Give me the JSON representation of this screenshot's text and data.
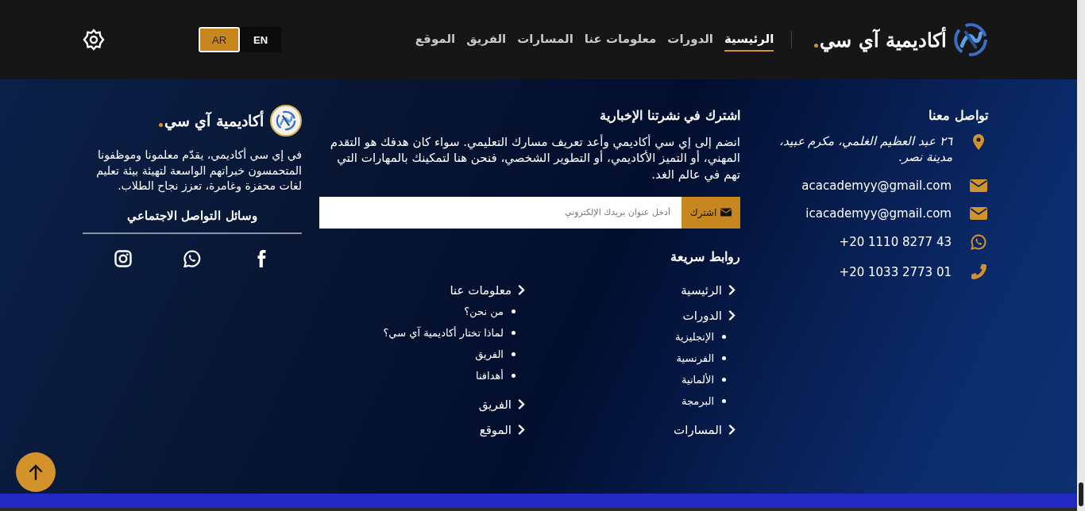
{
  "header": {
    "brand": "أكاديمية آي سي",
    "nav": [
      {
        "label": "الرئيسية",
        "selected": true
      },
      {
        "label": "الدورات",
        "selected": false
      },
      {
        "label": "معلومات عنا",
        "selected": false
      },
      {
        "label": "المسارات",
        "selected": false
      },
      {
        "label": "الفريق",
        "selected": false
      },
      {
        "label": "الموقع",
        "selected": false
      }
    ],
    "languages": [
      {
        "label": "EN",
        "selected": false
      },
      {
        "label": "AR",
        "selected": true
      }
    ]
  },
  "contact": {
    "title": "تواصل معنا",
    "items": [
      {
        "kind": "location",
        "text": "٢٦ عبد العظيم الغلمي، مكرم عبيد، مدينة نصر."
      },
      {
        "kind": "email",
        "text": "acacademyy@gmail.com"
      },
      {
        "kind": "email",
        "text": "icacademyy@gmail.com"
      },
      {
        "kind": "whatsapp",
        "text": "+20 1110 8277 43"
      },
      {
        "kind": "phone",
        "text": "+20 1033 2773 01"
      }
    ]
  },
  "newsletter": {
    "title": "اشترك في نشرتنا الإخبارية",
    "text": "انضم إلى إي سي أكاديمي وأعد تعريف مسارك التعليمي. سواء كان هدفك هو التقدم المهني، أو التميز الأكاديمي، أو التطوير الشخصي، فنحن هنا لتمكينك بالمهارات التي تهم في عالم الغد.",
    "placeholder": "أدخل عنوان بريدك الإلكتروني",
    "button": "اشترك"
  },
  "quick_links": {
    "title": "روابط سريعة",
    "columns": [
      {
        "items": [
          {
            "label": "الرئيسية"
          },
          {
            "label": "الدورات",
            "children": [
              {
                "label": "الإنجليزية"
              },
              {
                "label": "الفرنسية"
              },
              {
                "label": "الألمانية"
              },
              {
                "label": "البرمجة"
              }
            ]
          },
          {
            "label": "المسارات"
          }
        ]
      },
      {
        "items": [
          {
            "label": "معلومات عنا",
            "children": [
              {
                "label": "من نحن؟"
              },
              {
                "label": "لماذا تختار أكاديمية آي سي؟"
              },
              {
                "label": "الفريق"
              },
              {
                "label": "أهدافنا"
              }
            ]
          },
          {
            "label": "الفريق"
          },
          {
            "label": "الموقع"
          }
        ]
      }
    ]
  },
  "about": {
    "brand": "أكاديمية آي سي",
    "text": "في إي سي أكاديمي، يقدّم معلمونا وموظفونا المتحمسون خبراتهم الواسعة لتهيئة بيئة تعليم لغات محفزة وغامرة، تعزز نجاح الطلاب.",
    "social_title": "وسائل التواصل الاجتماعي",
    "social": [
      {
        "kind": "facebook"
      },
      {
        "kind": "whatsapp"
      },
      {
        "kind": "instagram"
      }
    ]
  }
}
